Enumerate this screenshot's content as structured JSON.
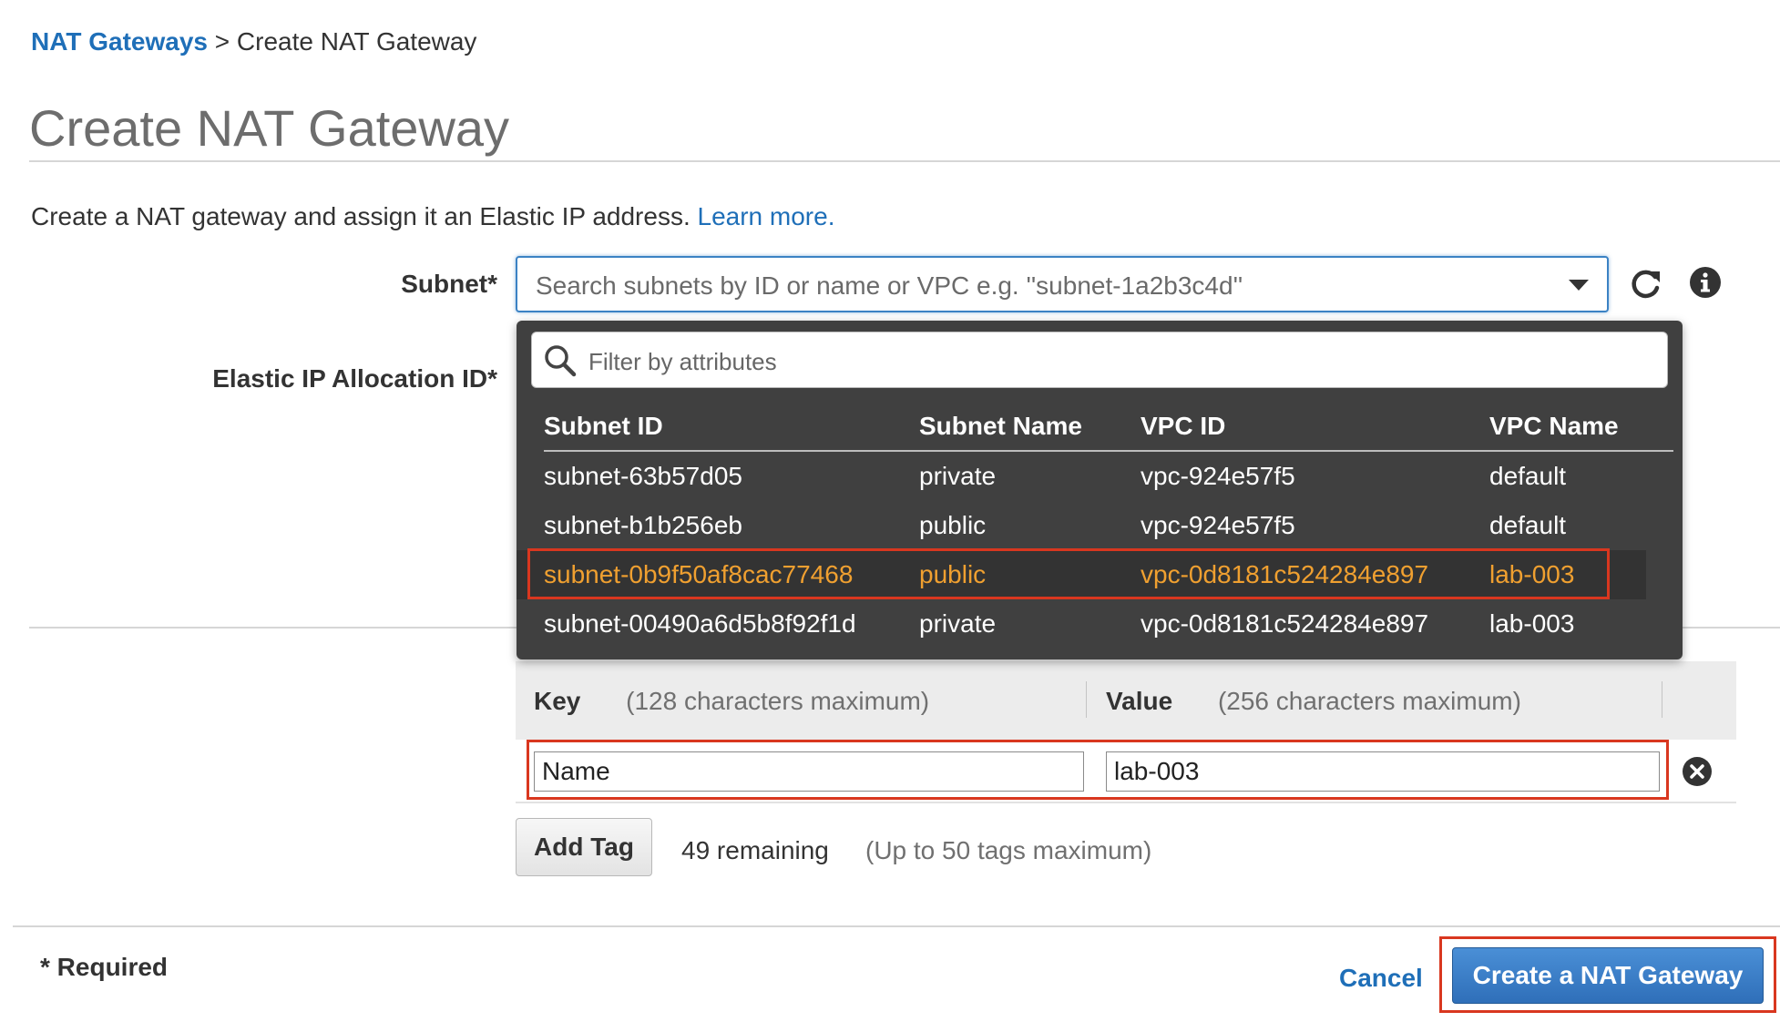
{
  "breadcrumb": {
    "parent": "NAT Gateways",
    "separator": ">",
    "current": "Create NAT Gateway"
  },
  "page": {
    "title": "Create NAT Gateway",
    "intro": "Create a NAT gateway and assign it an Elastic IP address.",
    "learn_more": "Learn more."
  },
  "form": {
    "subnet_label": "Subnet*",
    "subnet_placeholder": "Search subnets by ID or name or VPC e.g. ''subnet-1a2b3c4d''",
    "eip_label": "Elastic IP Allocation ID*"
  },
  "dropdown": {
    "filter_placeholder": "Filter by attributes",
    "columns": [
      "Subnet ID",
      "Subnet Name",
      "VPC ID",
      "VPC Name"
    ],
    "rows": [
      {
        "subnet_id": "subnet-63b57d05",
        "subnet_name": "private",
        "vpc_id": "vpc-924e57f5",
        "vpc_name": "default"
      },
      {
        "subnet_id": "subnet-b1b256eb",
        "subnet_name": "public",
        "vpc_id": "vpc-924e57f5",
        "vpc_name": "default"
      },
      {
        "subnet_id": "subnet-0b9f50af8cac77468",
        "subnet_name": "public",
        "vpc_id": "vpc-0d8181c524284e897",
        "vpc_name": "lab-003"
      },
      {
        "subnet_id": "subnet-00490a6d5b8f92f1d",
        "subnet_name": "private",
        "vpc_id": "vpc-0d8181c524284e897",
        "vpc_name": "lab-003"
      }
    ],
    "highlighted_row": 2,
    "highlight_color": "#f0a030"
  },
  "tags": {
    "key_header": "Key",
    "key_hint": "(128 characters maximum)",
    "value_header": "Value",
    "value_hint": "(256 characters maximum)",
    "key_value": "Name",
    "value_value": "lab-003",
    "add_tag": "Add Tag",
    "remaining": "49 remaining",
    "max_hint": "(Up to 50 tags maximum)"
  },
  "footer": {
    "required": "* Required",
    "cancel": "Cancel",
    "create": "Create a NAT Gateway"
  },
  "colors": {
    "link": "#1f6fb8",
    "primary": "#2f6fb9",
    "annotation": "#d9371f"
  },
  "icons": [
    "refresh-icon",
    "info-icon",
    "search-icon",
    "remove-icon",
    "dropdown-caret-icon"
  ]
}
